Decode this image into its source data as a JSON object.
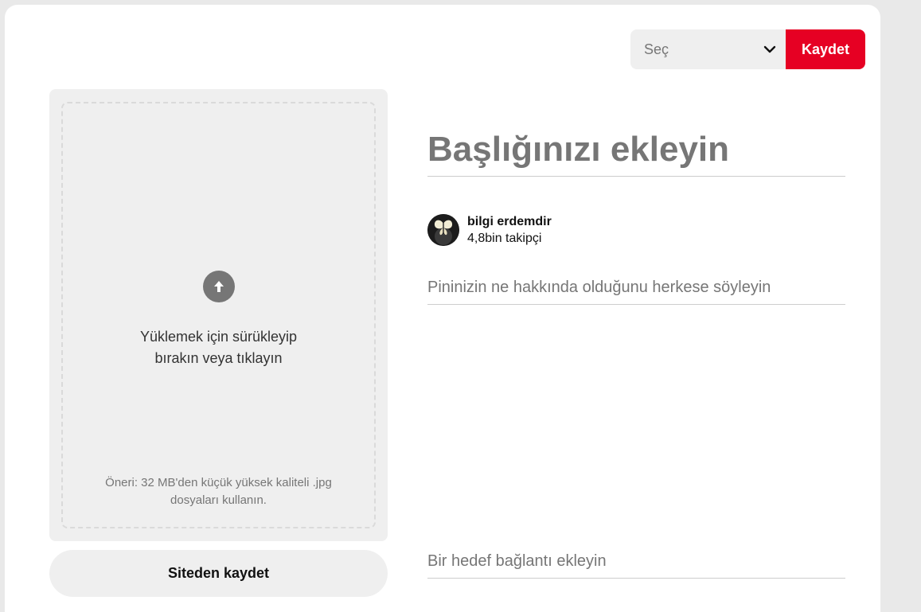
{
  "header": {
    "board_select_label": "Seç",
    "save_label": "Kaydet"
  },
  "upload": {
    "line1": "Yüklemek için sürükleyip",
    "line2": "bırakın veya tıklayın",
    "hint_line1": "Öneri: 32 MB'den küçük yüksek kaliteli .jpg",
    "hint_line2": "dosyaları kullanın."
  },
  "site_save_label": "Siteden kaydet",
  "form": {
    "title_placeholder": "Başlığınızı ekleyin",
    "description_placeholder": "Pininizin ne hakkında olduğunu herkese söyleyin",
    "link_placeholder": "Bir hedef bağlantı ekleyin"
  },
  "user": {
    "name": "bilgi erdemdir",
    "followers": "4,8bin takipçi"
  },
  "colors": {
    "accent": "#e60023",
    "panel": "#efefef",
    "muted_text": "#767676"
  },
  "icons": {
    "chevron": "chevron-down-icon",
    "upload": "arrow-up-circle-icon",
    "avatar": "butterfly-avatar"
  }
}
